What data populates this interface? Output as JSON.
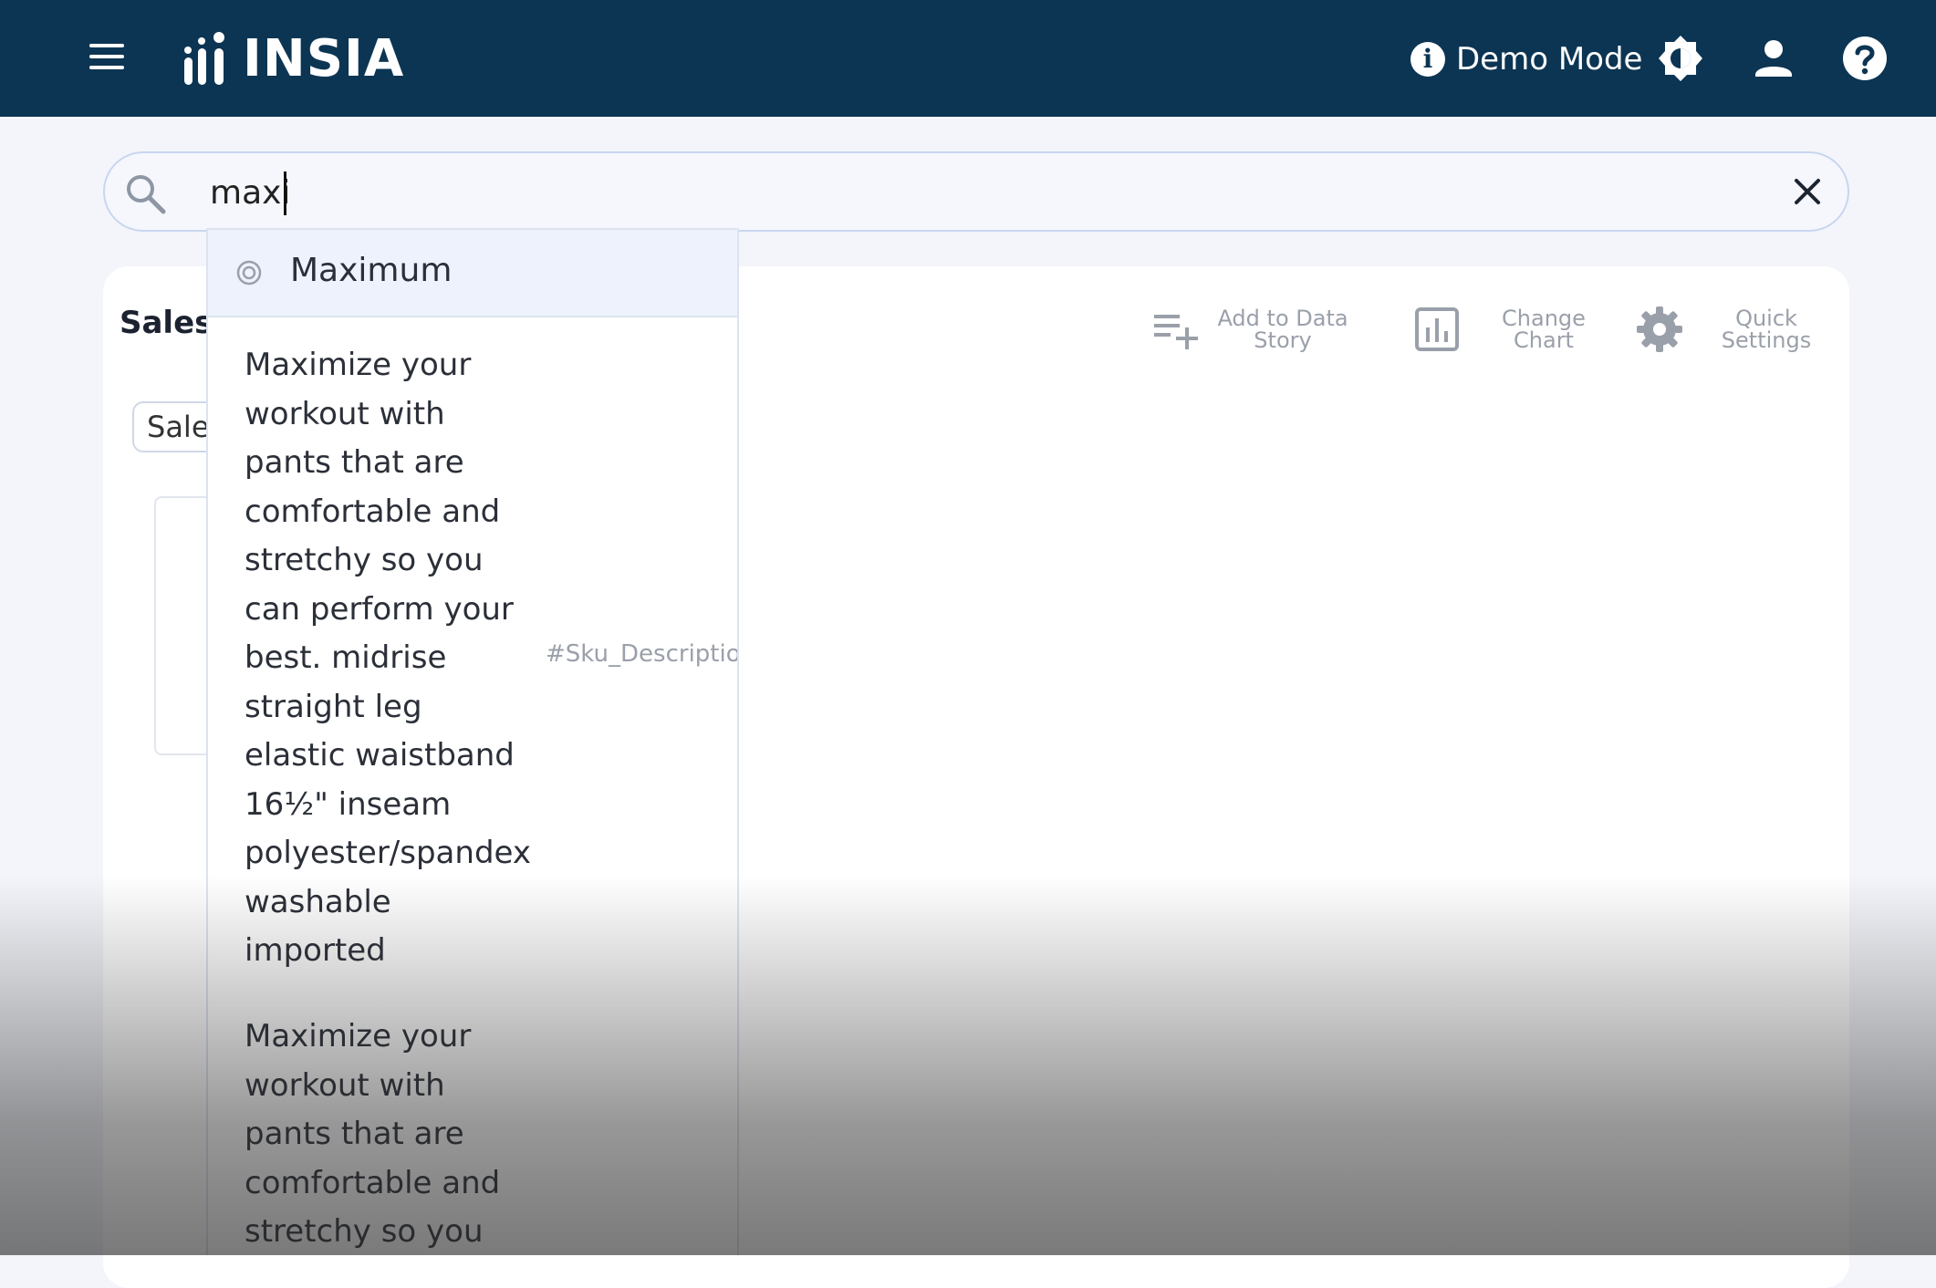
{
  "header": {
    "logo_text": "INSIA",
    "demo_mode_label": "Demo Mode"
  },
  "search": {
    "value": "maxi"
  },
  "card": {
    "title": "Sales",
    "chip_label": "Sale",
    "actions": [
      {
        "label": "Add to Data Story",
        "icon": "playlist-add-icon"
      },
      {
        "label": "Change Chart",
        "icon": "bar-chart-icon"
      },
      {
        "label": "Quick Settings",
        "icon": "gear-icon"
      }
    ]
  },
  "dropdown": {
    "top_suggestion": "Maximum",
    "items": [
      {
        "text": "Maximize your\nworkout with\npants that are\ncomfortable and\nstretchy so you\ncan perform your\nbest. midrise\nstraight leg\nelastic waistband\n16½\" inseam\npolyester/spandex\nwashable\nimported",
        "tag": "#Sku_Description"
      },
      {
        "text": "Maximize your\nworkout with\npants that are\ncomfortable and\nstretchy so you",
        "tag": ""
      }
    ]
  },
  "colors": {
    "header_bg": "#0c3553",
    "accent_light": "#eef2fc"
  }
}
